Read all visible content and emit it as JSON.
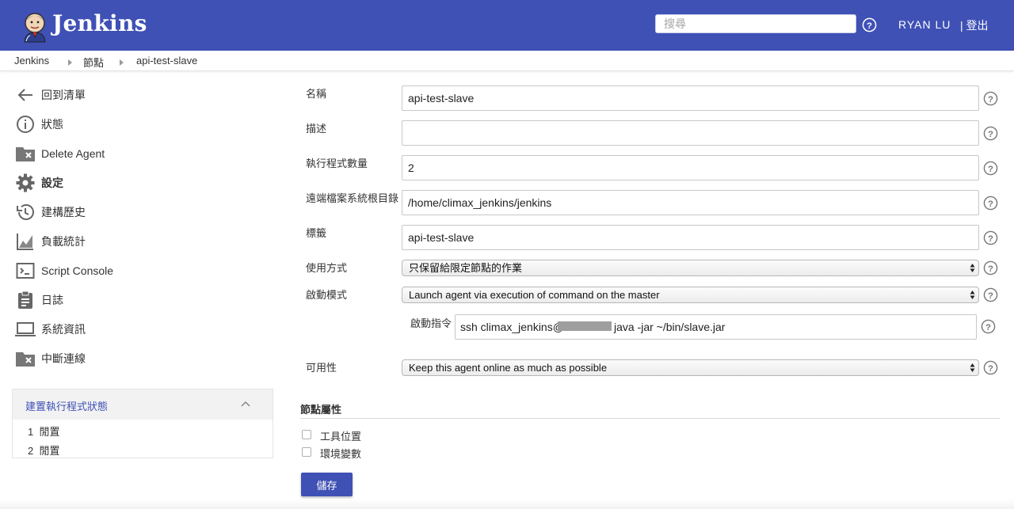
{
  "header": {
    "brand": "Jenkins",
    "search_placeholder": "搜尋",
    "user": "RYAN LU",
    "logout": "| 登出",
    "color": "#3f51b5"
  },
  "breadcrumb": [
    "Jenkins",
    "節點",
    "api-test-slave"
  ],
  "sidebar": {
    "items": [
      {
        "label": "回到清單",
        "icon": "back-arrow-icon"
      },
      {
        "label": "狀態",
        "icon": "info-icon"
      },
      {
        "label": "Delete Agent",
        "icon": "folder-delete-icon"
      },
      {
        "label": "設定",
        "icon": "gear-icon"
      },
      {
        "label": "建構歷史",
        "icon": "history-icon"
      },
      {
        "label": "負載統計",
        "icon": "chart-icon"
      },
      {
        "label": "Script Console",
        "icon": "terminal-icon"
      },
      {
        "label": "日誌",
        "icon": "clipboard-icon"
      },
      {
        "label": "系統資訊",
        "icon": "laptop-icon"
      },
      {
        "label": "中斷連線",
        "icon": "folder-disconnect-icon"
      }
    ],
    "executors": {
      "title": "建置執行程式狀態",
      "rows": [
        {
          "num": "1",
          "status": "閒置"
        },
        {
          "num": "2",
          "status": "閒置"
        }
      ]
    }
  },
  "form": {
    "name": {
      "label": "名稱",
      "value": "api-test-slave"
    },
    "description": {
      "label": "描述",
      "value": ""
    },
    "executors": {
      "label": "執行程式數量",
      "value": "2"
    },
    "remote_fs": {
      "label": "遠端檔案系統根目錄",
      "value": "/home/climax_jenkins/jenkins"
    },
    "labels": {
      "label": "標籤",
      "value": "api-test-slave"
    },
    "usage": {
      "label": "使用方式",
      "value": "只保留給限定節點的作業"
    },
    "launch": {
      "label": "啟動模式",
      "value": "Launch agent via execution of command on the master"
    },
    "launch_command": {
      "label": "啟動指令",
      "prefix": "ssh climax_jenkins@",
      "suffix": "java -jar ~/bin/slave.jar"
    },
    "availability": {
      "label": "可用性",
      "value": "Keep this agent online as much as possible"
    },
    "node_properties": {
      "title": "節點屬性",
      "options": [
        {
          "label": "工具位置",
          "checked": false
        },
        {
          "label": "環境變數",
          "checked": false
        }
      ]
    },
    "save": "儲存"
  }
}
